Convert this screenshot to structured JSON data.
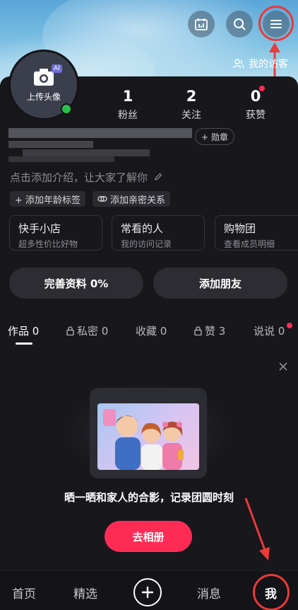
{
  "header": {
    "visitor_label": "我的访客"
  },
  "profile": {
    "avatar_label": "上传头像",
    "ai_badge": "AI",
    "stats": [
      {
        "value": "1",
        "label": "粉丝"
      },
      {
        "value": "2",
        "label": "关注"
      },
      {
        "value": "0",
        "label": "获赞"
      }
    ],
    "medal_label": "+ 勋章",
    "intro": "点击添加介绍，让大家了解你",
    "tags": [
      "+ 添加年龄标签",
      "添加亲密关系"
    ]
  },
  "cards": [
    {
      "title": "快手小店",
      "subtitle": "超多性价比好物"
    },
    {
      "title": "常看的人",
      "subtitle": "我的访问记录"
    },
    {
      "title": "购物团",
      "subtitle": "查看成员明细"
    }
  ],
  "actions": {
    "complete_profile": "完善资料 0%",
    "add_friends": "添加朋友"
  },
  "tabs": [
    {
      "label": "作品 0"
    },
    {
      "label": "私密 0"
    },
    {
      "label": "收藏 0"
    },
    {
      "label": "赞 3"
    },
    {
      "label": "说说 0"
    }
  ],
  "promo": {
    "text": "晒一晒和家人的合影，记录团圆时刻",
    "button": "去相册"
  },
  "nav": {
    "home": "首页",
    "featured": "精选",
    "messages": "消息",
    "me": "我"
  },
  "colors": {
    "accent": "#fe2c55",
    "annotation_red": "#ea3a3a",
    "online": "#27c24c"
  }
}
